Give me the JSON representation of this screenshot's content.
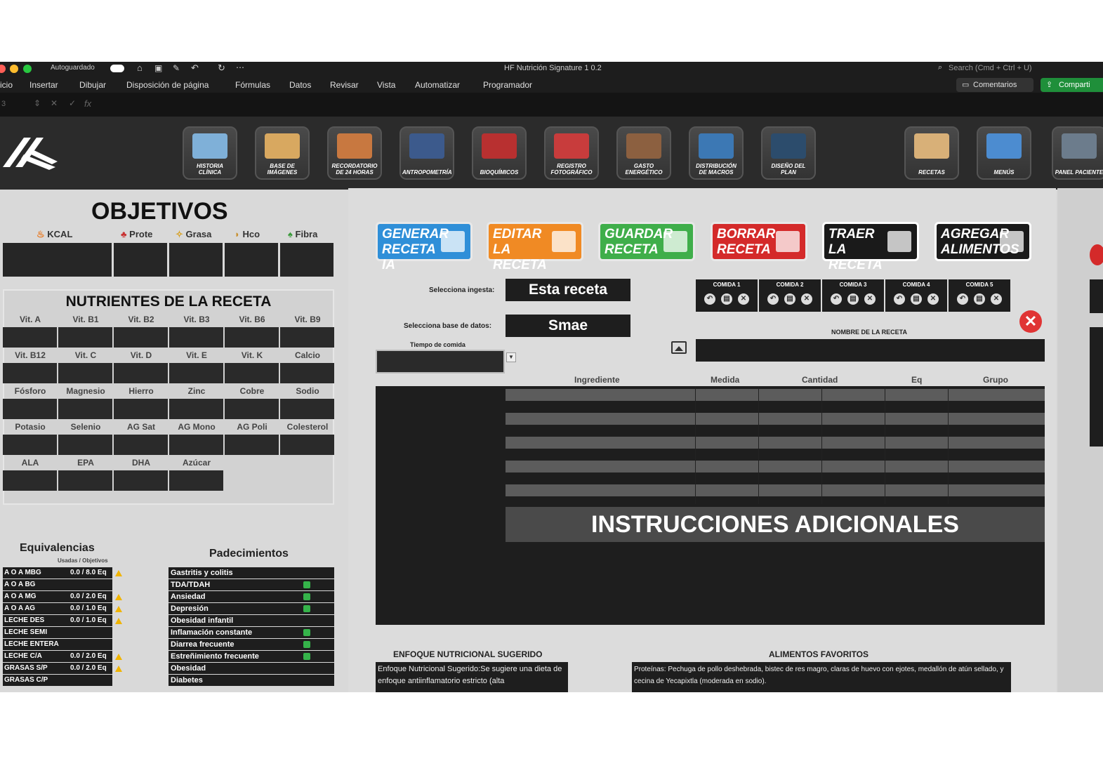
{
  "window": {
    "autosave_label": "Autoguardado",
    "title": "HF Nutrición Signature 1 0.2",
    "search_placeholder": "Search (Cmd + Ctrl + U)"
  },
  "menu": [
    "icio",
    "Insertar",
    "Dibujar",
    "Disposición de página",
    "Fórmulas",
    "Datos",
    "Revisar",
    "Vista",
    "Automatizar",
    "Programador"
  ],
  "menu_right": {
    "comments": "Comentarios",
    "share": "Comparti"
  },
  "formula": {
    "cell_ref": "3",
    "fx": "fx"
  },
  "ribbon": [
    {
      "caption": "HISTORIA CLÍNICA",
      "icon": "folder-icon",
      "color": "#7fb0d8"
    },
    {
      "caption": "BASE DE IMÁGENES",
      "icon": "photos-icon",
      "color": "#d8a860"
    },
    {
      "caption": "RECORDATORIO DE 24 HORAS",
      "icon": "food-icon",
      "color": "#c87840"
    },
    {
      "caption": "ANTROPOMETRÍA",
      "icon": "body-icon",
      "color": "#3c5a8c"
    },
    {
      "caption": "BIOQUÍMICOS",
      "icon": "test-tubes-icon",
      "color": "#b83030"
    },
    {
      "caption": "REGISTRO FOTOGRÁFICO",
      "icon": "before-after-icon",
      "color": "#c83c3c"
    },
    {
      "caption": "GASTO ENERGÉTICO",
      "icon": "athlete-icon",
      "color": "#8c6040"
    },
    {
      "caption": "DISTRIBUCIÓN DE MACROS",
      "icon": "stopwatch-icon",
      "color": "#3c78b4"
    },
    {
      "caption": "DISEÑO DEL PLAN",
      "icon": "plan-icon",
      "color": "#2c4c6c"
    },
    {
      "caption": "RECETAS",
      "icon": "recipe-book-icon",
      "color": "#d8b078"
    },
    {
      "caption": "MENÚS",
      "icon": "clipboard-icon",
      "color": "#4c8cd0"
    },
    {
      "caption": "PANEL PACIENTE",
      "icon": "laptop-icon",
      "color": "#6c7c8c"
    }
  ],
  "objetivos": {
    "title": "OBJETIVOS",
    "labels": [
      "KCAL",
      "Prote",
      "Grasa",
      "Hco",
      "Fibra"
    ]
  },
  "nutrientes": {
    "title": "NUTRIENTES DE LA RECETA",
    "rows": [
      [
        "Vit. A",
        "Vit. B1",
        "Vit. B2",
        "Vit. B3",
        "Vit. B6",
        "Vit. B9"
      ],
      [
        "Vit. B12",
        "Vit. C",
        "Vit. D",
        "Vit. E",
        "Vit. K",
        "Calcio"
      ],
      [
        "Fósforo",
        "Magnesio",
        "Hierro",
        "Zinc",
        "Cobre",
        "Sodio"
      ],
      [
        "Potasio",
        "Selenio",
        "AG Sat",
        "AG Mono",
        "AG Poli",
        "Colesterol"
      ],
      [
        "ALA",
        "EPA",
        "DHA",
        "Azúcar"
      ]
    ]
  },
  "actions": [
    {
      "label": "GENERAR RECETA IA",
      "color": "#2f8fd8",
      "icon": "book-icon"
    },
    {
      "label": "EDITAR LA RECETA",
      "color": "#f08a24",
      "icon": "document-icon"
    },
    {
      "label": "GUARDAR RECETA",
      "color": "#3fae4a",
      "icon": "bowl-icon"
    },
    {
      "label": "BORRAR RECETA",
      "color": "#d42a2a",
      "icon": "trash-icon"
    },
    {
      "label": "TRAER LA RECETA",
      "color": "#1a1a1a",
      "icon": "image-icon"
    },
    {
      "label": "AGREGAR ALIMENTOS",
      "color": "#1a1a1a",
      "icon": "grocery-icon"
    }
  ],
  "form": {
    "ingesta_label": "Selecciona ingesta:",
    "ingesta_value": "Esta receta",
    "base_label": "Selecciona base de datos:",
    "base_value": "Smae",
    "tiempo_label": "Tiempo de comida",
    "nombre_label": "NOMBRE DE LA RECETA"
  },
  "comidas": [
    "COMIDA 1",
    "COMIDA 2",
    "COMIDA 3",
    "COMIDA 4",
    "COMIDA 5"
  ],
  "table": {
    "headers": [
      "Ingrediente",
      "Medida",
      "Cantidad",
      "Eq",
      "Grupo"
    ]
  },
  "instrucciones": "INSTRUCCIONES ADICIONALES",
  "equivalencias": {
    "title": "Equivalencias",
    "subtitle": "Usadas / Objetivos",
    "rows": [
      {
        "name": "A O A MBG",
        "value": "0.0 / 8.0 Eq",
        "warn": true
      },
      {
        "name": "A O A BG",
        "value": "",
        "warn": false
      },
      {
        "name": "A O A MG",
        "value": "0.0 / 2.0 Eq",
        "warn": true
      },
      {
        "name": "A O A AG",
        "value": "0.0 / 1.0 Eq",
        "warn": true
      },
      {
        "name": "LECHE DES",
        "value": "0.0 / 1.0 Eq",
        "warn": true
      },
      {
        "name": "LECHE SEMI",
        "value": "",
        "warn": false
      },
      {
        "name": "LECHE ENTERA",
        "value": "",
        "warn": false
      },
      {
        "name": "LECHE C/A",
        "value": "0.0 / 2.0 Eq",
        "warn": true
      },
      {
        "name": "GRASAS S/P",
        "value": "0.0 / 2.0 Eq",
        "warn": true
      },
      {
        "name": "GRASAS C/P",
        "value": "",
        "warn": false
      }
    ]
  },
  "padecimientos": {
    "title": "Padecimientos",
    "rows": [
      {
        "name": "Gastritis y colitis",
        "checked": false
      },
      {
        "name": "TDA/TDAH",
        "checked": true
      },
      {
        "name": "Ansiedad",
        "checked": true
      },
      {
        "name": "Depresión",
        "checked": true
      },
      {
        "name": "Obesidad infantil",
        "checked": false
      },
      {
        "name": "Inflamación constante",
        "checked": true
      },
      {
        "name": "Diarrea frecuente",
        "checked": true
      },
      {
        "name": "Estreñimiento frecuente",
        "checked": true
      },
      {
        "name": "Obesidad",
        "checked": false
      },
      {
        "name": "Diabetes",
        "checked": false
      }
    ]
  },
  "enfoque": {
    "title": "ENFOQUE NUTRICIONAL SUGERIDO",
    "text": "Enfoque Nutricional Sugerido:Se sugiere una dieta de enfoque antiinflamatorio estricto (alta"
  },
  "favoritos": {
    "title": "ALIMENTOS FAVORITOS",
    "text": "Proteínas: Pechuga de pollo deshebrada, bistec de res magro, claras de huevo con ejotes, medallón de atún sellado, y cecina de Yecapixtla (moderada en sodio)."
  }
}
